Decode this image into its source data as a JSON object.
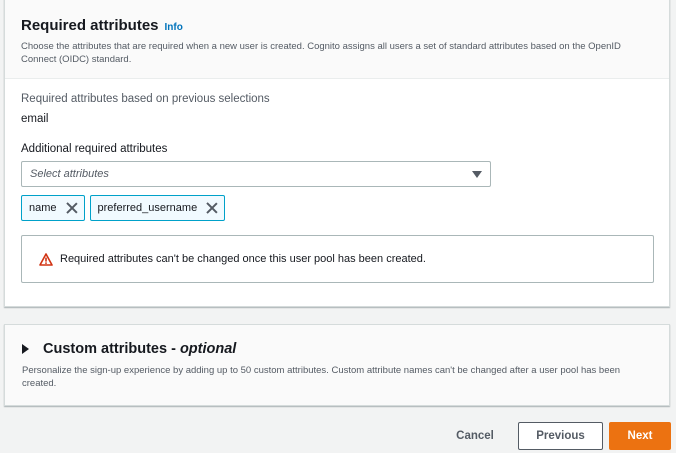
{
  "required_panel": {
    "title": "Required attributes",
    "info_link": "Info",
    "description": "Choose the attributes that are required when a new user is created. Cognito assigns all users a set of standard attributes based on the OpenID Connect (OIDC) standard.",
    "previous_label": "Required attributes based on previous selections",
    "previous_value": "email",
    "additional_label": "Additional required attributes",
    "select_placeholder": "Select attributes",
    "tokens": [
      "name",
      "preferred_username"
    ],
    "warning": "Required attributes can't be changed once this user pool has been created."
  },
  "custom_panel": {
    "title": "Custom attributes - ",
    "title_optional": "optional",
    "description": "Personalize the sign-up experience by adding up to 50 custom attributes. Custom attribute names can't be changed after a user pool has been created."
  },
  "footer": {
    "cancel": "Cancel",
    "previous": "Previous",
    "next": "Next"
  },
  "colors": {
    "primary": "#ec7211",
    "link": "#0073bb",
    "token_border": "#00a1c9",
    "warning_icon": "#d13212"
  },
  "icons": {
    "warning": "warning-triangle-icon",
    "dismiss": "close-icon",
    "caret": "caret-down-icon",
    "expand": "caret-right-icon"
  }
}
